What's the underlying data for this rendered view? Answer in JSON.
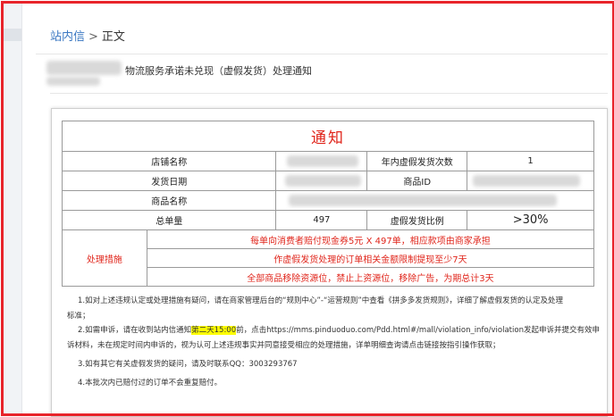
{
  "breadcrumb": {
    "link": "站内信",
    "separator": ">",
    "current": "正文"
  },
  "message": {
    "title": "物流服务承诺未兑现（虚假发货）处理通知"
  },
  "notice": {
    "title": "通知",
    "rows": {
      "store_label": "店铺名称",
      "yearly_label": "年内虚假发货次数",
      "yearly_value": "1",
      "ship_date_label": "发货日期",
      "product_id_label": "商品ID",
      "product_name_label": "商品名称",
      "orders_label": "总单量",
      "orders_value": "497",
      "ratio_label": "虚假发货比例",
      "ratio_value": ">30%"
    },
    "measures_label": "处理措施",
    "measures": [
      "每单向消费者赔付现金券5元 X 497单，相应款项由商家承担",
      "作虚假发货处理的订单相关金额限制提现至少7天",
      "全部商品移除资源位，禁止上资源位，移除广告，为期总计3天"
    ]
  },
  "notes": {
    "n1_a": "1.如对上述违规认定或处理措施有疑问，请在商家管理后台的“规则中心”-“运营规则”中查看《拼多多发货规则》，详细了解虚假发货的认定及处理",
    "n1_b": "标准；",
    "n2_pre": "2.如需申诉，请在收到站内信通知",
    "n2_highlight": "第二天15:00",
    "n2_post": "前，点击https://mms.pinduoduo.com/Pdd.html#/mall/violation_info/violation发起申诉并提交有效申",
    "n2_b": "诉材料，未在规定时间内申诉的，视为认可上述违规事实并同意接受相应的处理措施，详单明细查询请点击链接按指引操作获取；",
    "n3": "3.如有其它有关虚假发货的疑问，请及时联系QQ：3003293767",
    "n4": "4.本批次内已赔付过的订单不会重复赔付。"
  },
  "colors": {
    "frame": "#e8232a",
    "link": "#3b78c2",
    "notice_red": "#e0251b",
    "highlight": "#ffff00"
  }
}
